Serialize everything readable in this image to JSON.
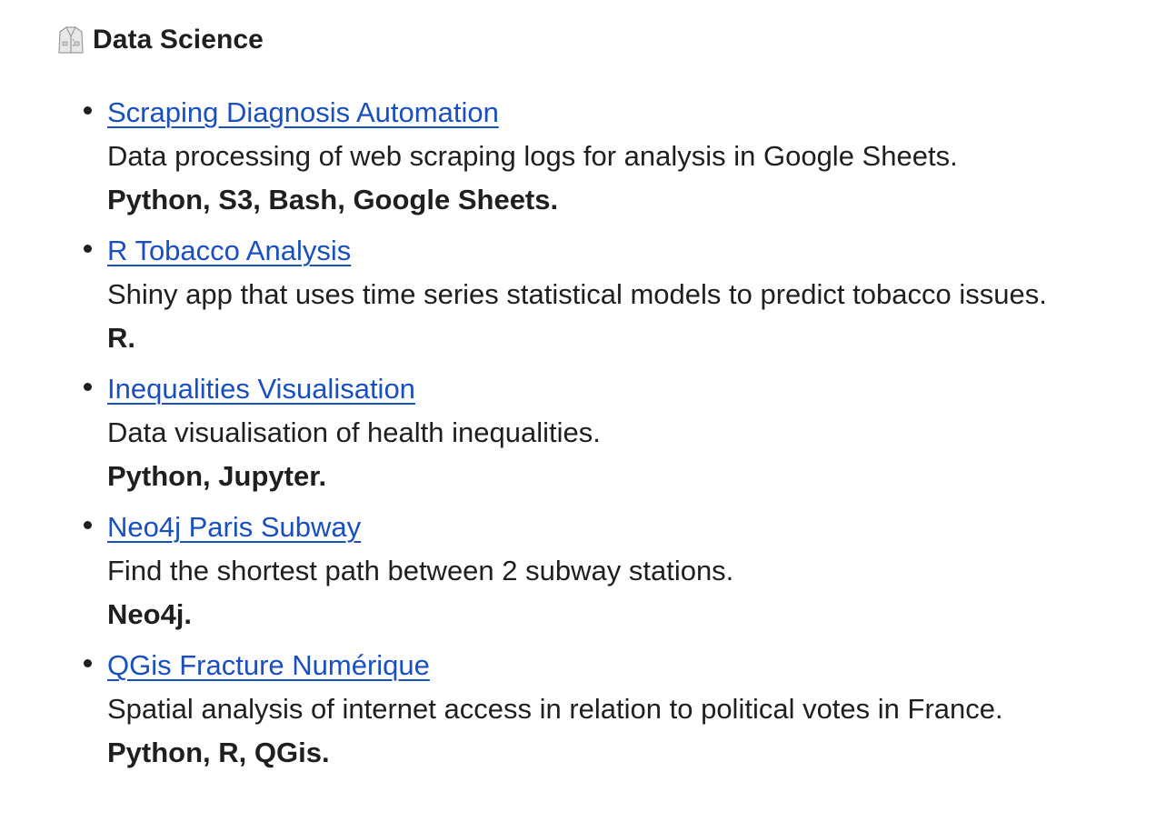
{
  "section": {
    "icon": "lab-coat-icon",
    "title": "Data Science"
  },
  "projects": [
    {
      "title": "Scraping Diagnosis Automation",
      "description": "Data processing of web scraping logs for analysis in Google Sheets.",
      "tech": "Python, S3, Bash, Google Sheets."
    },
    {
      "title": "R Tobacco Analysis",
      "description": "Shiny app that uses time series statistical models to predict tobacco issues.",
      "tech": "R."
    },
    {
      "title": "Inequalities Visualisation",
      "description": "Data visualisation of health inequalities.",
      "tech": "Python, Jupyter."
    },
    {
      "title": "Neo4j Paris Subway",
      "description": "Find the shortest path between 2 subway stations.",
      "tech": "Neo4j."
    },
    {
      "title": "QGis Fracture Numérique",
      "description": "Spatial analysis of internet access in relation to political votes in France.",
      "tech": "Python, R, QGis."
    }
  ],
  "colors": {
    "link": "#1a4fbf",
    "text": "#1f1f1f"
  }
}
